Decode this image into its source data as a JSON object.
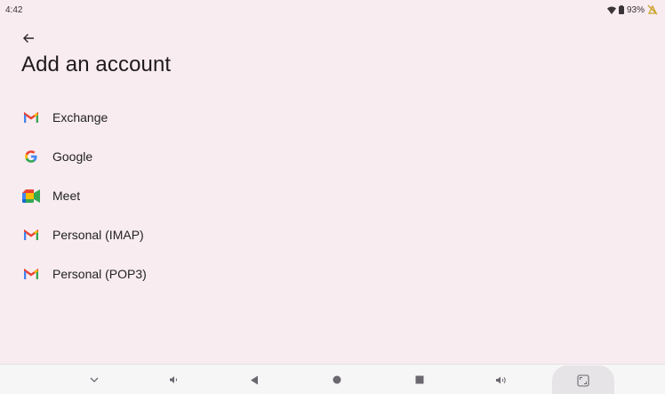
{
  "status_bar": {
    "time": "4:42",
    "battery": "93%",
    "icons": [
      "wifi-icon",
      "battery-icon",
      "no-location-icon"
    ]
  },
  "header": {
    "back_icon": "arrow-left-icon",
    "title": "Add an account"
  },
  "accounts": [
    {
      "label": "Exchange",
      "icon": "gmail-icon"
    },
    {
      "label": "Google",
      "icon": "google-icon"
    },
    {
      "label": "Meet",
      "icon": "meet-icon"
    },
    {
      "label": "Personal (IMAP)",
      "icon": "gmail-icon"
    },
    {
      "label": "Personal (POP3)",
      "icon": "gmail-icon"
    }
  ],
  "nav_bar": {
    "buttons": [
      "chevron-down-icon",
      "volume-down-icon",
      "back-triangle-icon",
      "home-circle-icon",
      "recents-square-icon",
      "volume-up-icon",
      "screenshot-icon"
    ]
  },
  "colors": {
    "background": "#f8ecf0",
    "nav_background": "#f7f6f7",
    "text": "#1f1a1d"
  }
}
